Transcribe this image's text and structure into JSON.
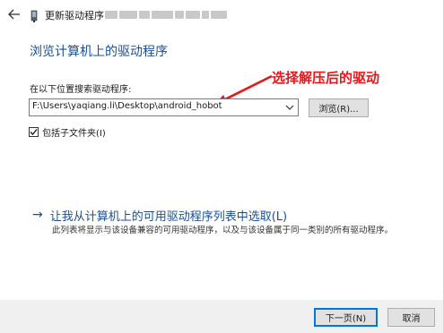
{
  "window": {
    "title": "更新驱动程序 -",
    "device_name_obscured": "blurred device name"
  },
  "heading": "浏览计算机上的驱动程序",
  "annotation": "选择解压后的驱动",
  "annotation_color": "#e8151b",
  "path_label": "在以下位置搜索驱动程序:",
  "path_value": "F:\\Users\\yaqiang.li\\Desktop\\android_hobot",
  "browse_button": "浏览(R)...",
  "include_subfolders": {
    "label": "包括子文件夹(I)",
    "checked": true
  },
  "pick_link": {
    "text": "让我从计算机上的可用驱动程序列表中选取(L)",
    "description": "此列表将显示与该设备兼容的可用驱动程序，以及与该设备属于同一类别的所有驱动程序。"
  },
  "footer": {
    "next": "下一页(N)",
    "cancel": "取消"
  },
  "colors": {
    "link": "#1b4f95",
    "focus": "#0078d7"
  }
}
